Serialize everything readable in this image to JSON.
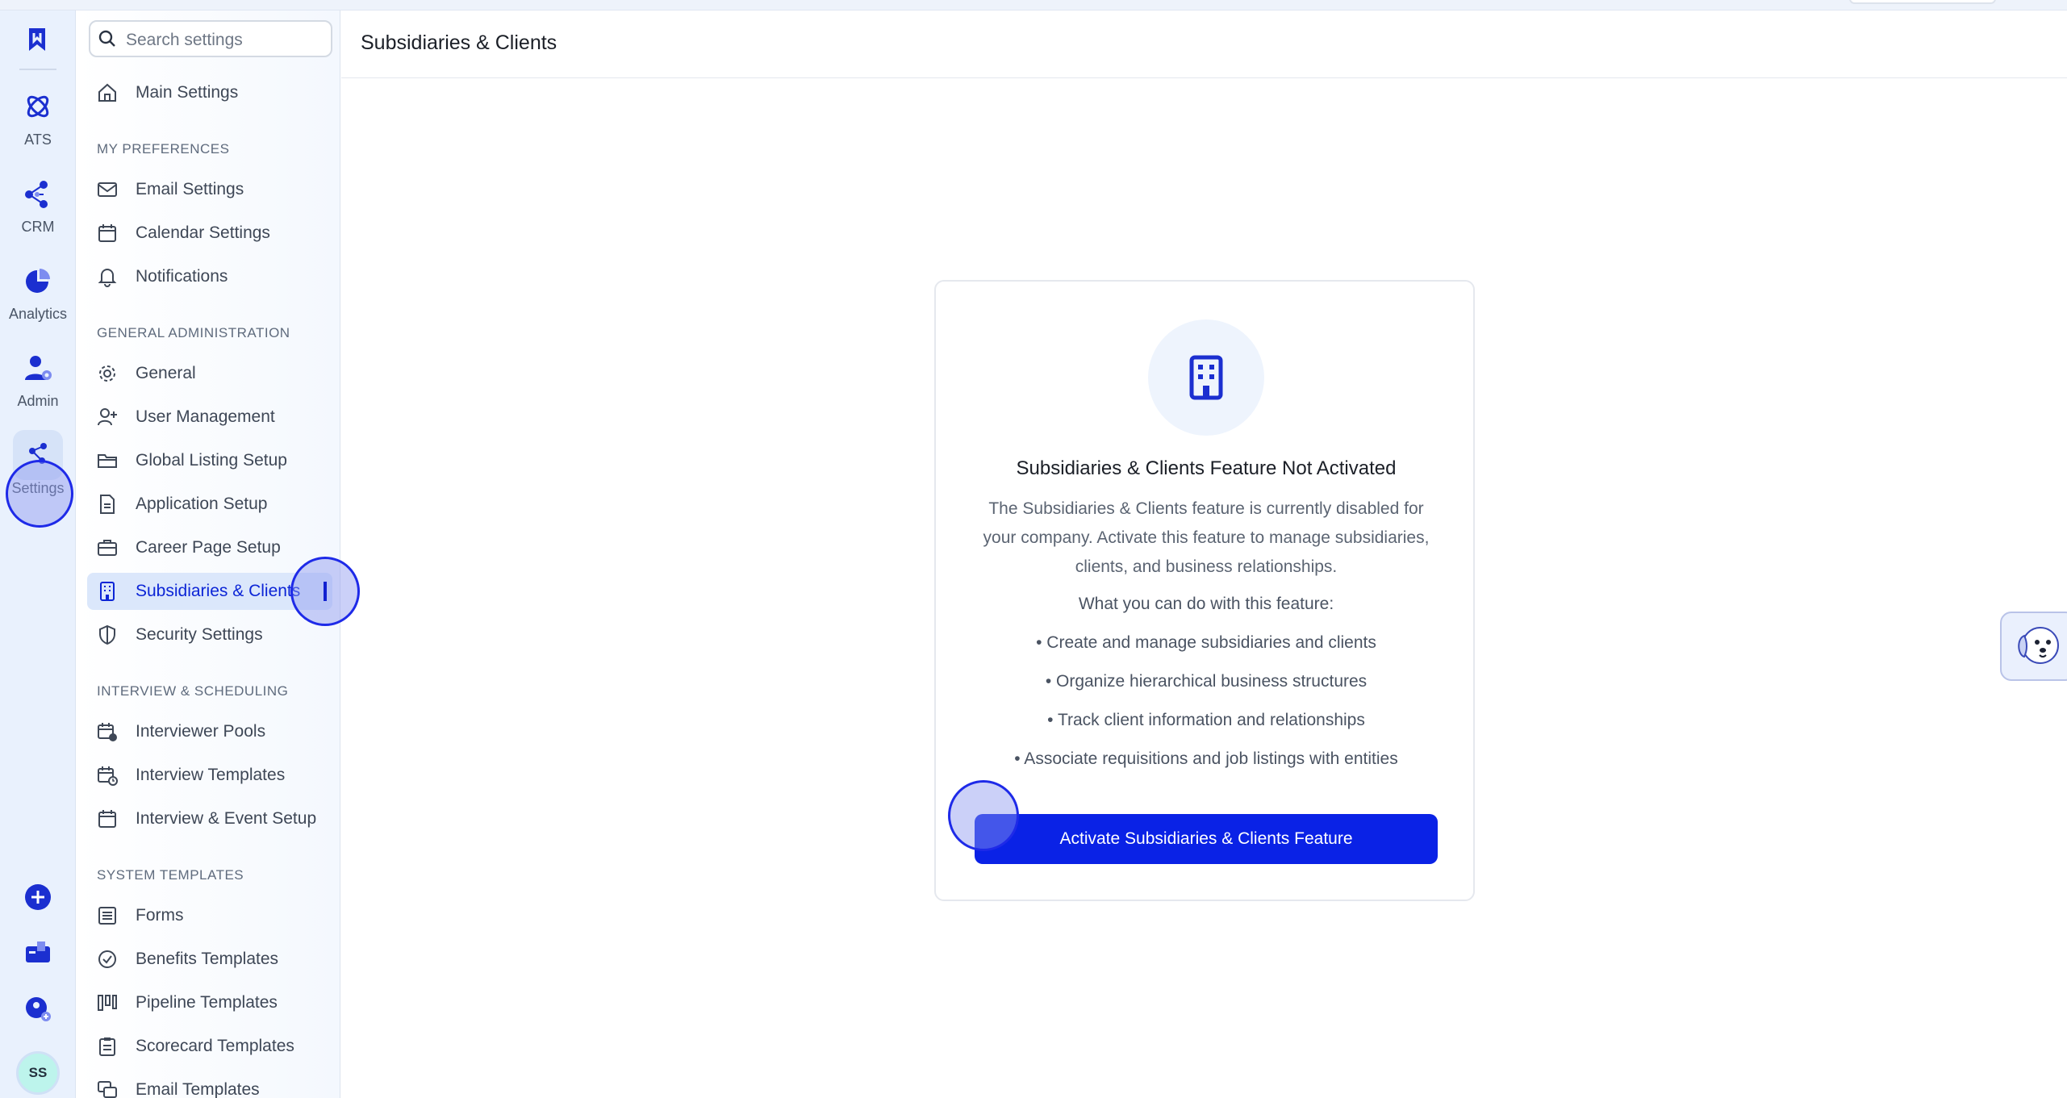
{
  "top": {},
  "rail": {
    "items": [
      {
        "label": "ATS",
        "icon": "atom-icon"
      },
      {
        "label": "CRM",
        "icon": "network-icon"
      },
      {
        "label": "Analytics",
        "icon": "pie-chart-icon"
      },
      {
        "label": "Admin",
        "icon": "user-gear-icon"
      },
      {
        "label": "Settings",
        "icon": "share-nodes-icon"
      }
    ],
    "avatar_initials": "SS"
  },
  "sidebar": {
    "search_placeholder": "Search settings",
    "main_settings": "Main Settings",
    "sections": {
      "my_preferences": "MY PREFERENCES",
      "general_administration": "GENERAL ADMINISTRATION",
      "interview_scheduling": "INTERVIEW & SCHEDULING",
      "system_templates": "SYSTEM TEMPLATES"
    },
    "items": {
      "email_settings": "Email Settings",
      "calendar_settings": "Calendar Settings",
      "notifications": "Notifications",
      "general": "General",
      "user_management": "User Management",
      "global_listing_setup": "Global Listing Setup",
      "application_setup": "Application Setup",
      "career_page_setup": "Career Page Setup",
      "subsidiaries_clients": "Subsidiaries & Clients",
      "security_settings": "Security Settings",
      "interviewer_pools": "Interviewer Pools",
      "interview_templates": "Interview Templates",
      "interview_event_setup": "Interview & Event Setup",
      "forms": "Forms",
      "benefits_templates": "Benefits Templates",
      "pipeline_templates": "Pipeline Templates",
      "scorecard_templates": "Scorecard Templates",
      "email_templates": "Email Templates"
    }
  },
  "main": {
    "title": "Subsidiaries & Clients",
    "card": {
      "title": "Subsidiaries & Clients Feature Not Activated",
      "description": "The Subsidiaries & Clients feature is currently disabled for your company. Activate this feature to manage subsidiaries, clients, and business relationships.",
      "subheading": "What you can do with this feature:",
      "bullets": [
        "• Create and manage subsidiaries and clients",
        "• Organize hierarchical business structures",
        "• Track client information and relationships",
        "• Associate requisitions and job listings with entities"
      ],
      "button_label": "Activate Subsidiaries & Clients Feature"
    }
  },
  "colors": {
    "accent": "#0a22e6",
    "active_nav_bg": "#dbe7fb",
    "rail_bg": "#e9f1fd"
  }
}
